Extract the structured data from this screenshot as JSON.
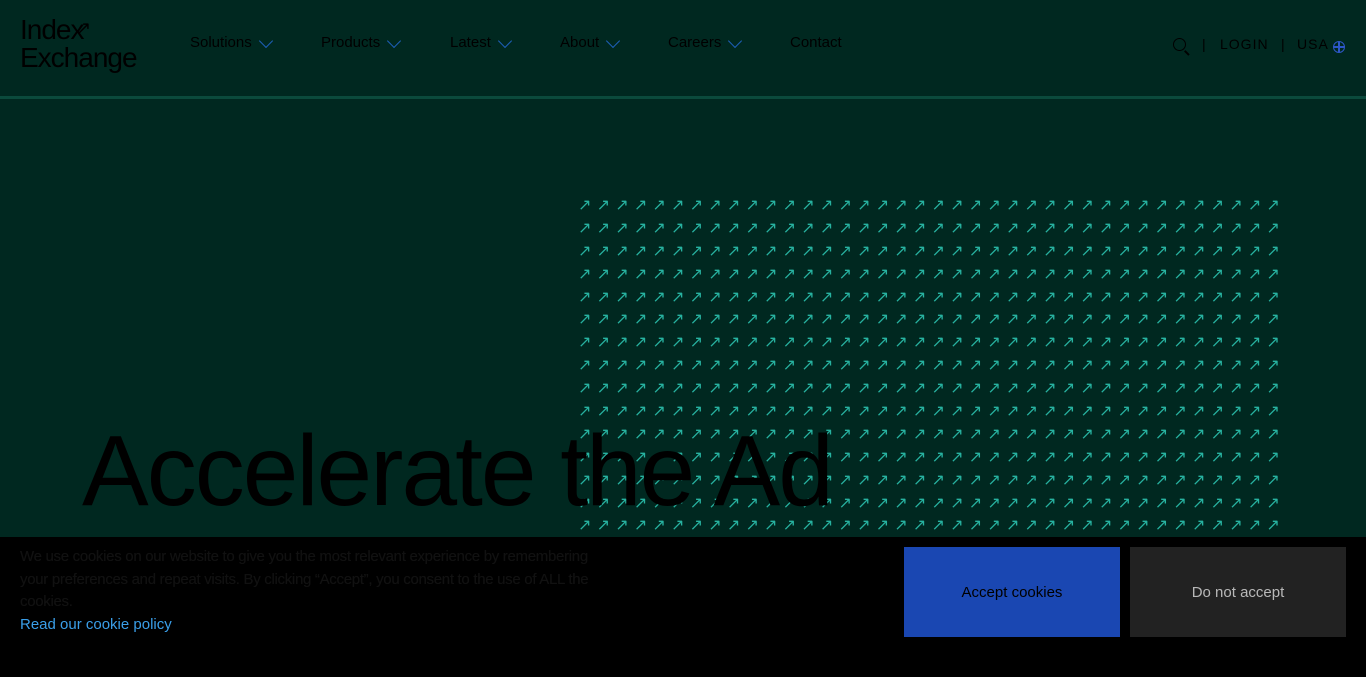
{
  "header": {
    "logo": {
      "line1": "Index",
      "line2": "Exchange",
      "mark": "↗"
    },
    "nav": [
      {
        "label": "Solutions",
        "has_dropdown": true
      },
      {
        "label": "Products",
        "has_dropdown": true
      },
      {
        "label": "Latest",
        "has_dropdown": true
      },
      {
        "label": "About",
        "has_dropdown": true
      },
      {
        "label": "Careers",
        "has_dropdown": true
      },
      {
        "label": "Contact",
        "has_dropdown": false
      }
    ],
    "search_icon": "search-icon",
    "separator": "|",
    "login_label": "LOGIN",
    "region_label": "USA",
    "region_icon": "globe-icon"
  },
  "hero": {
    "title": "Accelerate the Ad",
    "pattern_glyph": "↗"
  },
  "cookie_banner": {
    "text_lines": [
      "We use cookies on our website to give you the most relevant experience by remembering",
      "your preferences and repeat visits. By clicking “Accept”, you consent to the use of ALL the",
      "cookies."
    ],
    "policy_link": "Read our cookie policy",
    "accept_label": "Accept cookies",
    "decline_label": "Do not accept"
  },
  "colors": {
    "background": "#002820",
    "accent_teal": "#27b2a0",
    "accept_button": "#1a47b2",
    "decline_button": "#222222",
    "link": "#3a9ee8"
  }
}
